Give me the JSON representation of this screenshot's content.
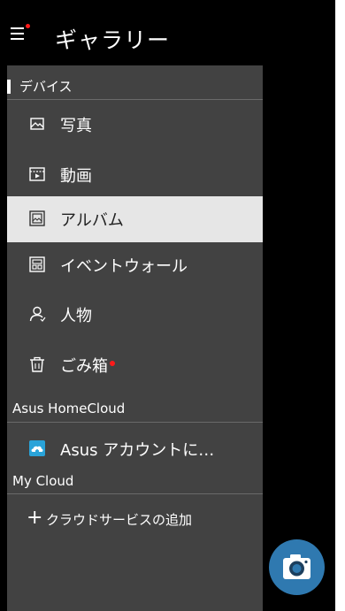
{
  "app": {
    "title": "ギャラリー"
  },
  "colors": {
    "accent_dot": "#ff1a1a",
    "fab": "#2f79b0",
    "selected_bg": "#e6e6e6",
    "drawer_bg": "#424242"
  },
  "drawer": {
    "devices_header": "デバイス",
    "items": [
      {
        "label": "写真",
        "icon": "photo-icon"
      },
      {
        "label": "動画",
        "icon": "video-icon"
      },
      {
        "label": "アルバム",
        "icon": "album-icon",
        "selected": true
      },
      {
        "label": "イベントウォール",
        "icon": "event-wall-icon"
      },
      {
        "label": "人物",
        "icon": "person-icon"
      },
      {
        "label": "ごみ箱",
        "icon": "trash-icon",
        "badge": true
      }
    ],
    "homecloud_header": "Asus HomeCloud",
    "asus_account": {
      "label": "Asus アカウントに…",
      "icon": "cloud-home-icon"
    },
    "mycloud_header": "My Cloud",
    "add_service": {
      "plus": "+",
      "label": "クラウドサービスの追加"
    }
  },
  "fab": {
    "icon": "camera-icon"
  }
}
